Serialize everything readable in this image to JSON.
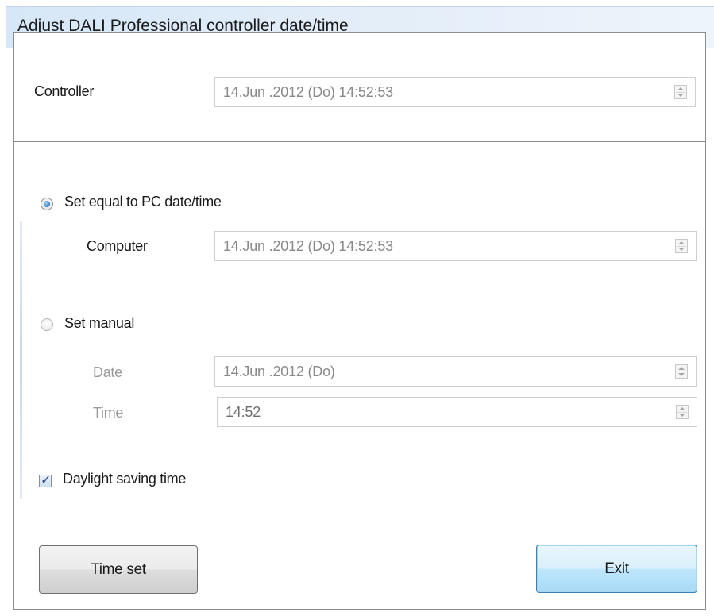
{
  "window": {
    "title": "Adjust DALI Professional controller date/time"
  },
  "controller": {
    "label": "Controller",
    "value": "14.Jun .2012 (Do)  14:52:53"
  },
  "options": {
    "pc_radio_label": "Set equal to PC date/time",
    "pc_radio_selected": true,
    "computer_label": "Computer",
    "computer_value": "14.Jun .2012 (Do)  14:52:53",
    "manual_radio_label": "Set manual",
    "manual_radio_selected": false,
    "date_label": "Date",
    "date_value": "14.Jun .2012 (Do)",
    "time_label": "Time",
    "time_value": "14:52"
  },
  "daylight": {
    "label": "Daylight saving time",
    "checked": true
  },
  "buttons": {
    "time_set": "Time set",
    "exit": "Exit"
  },
  "colors": {
    "accent": "#3c8ad0",
    "default_button_border": "#3c7fb1",
    "disabled_text": "#9a9a9a"
  },
  "icons": [
    "radio-selected-icon",
    "radio-unselected-icon",
    "checkbox-checked-icon",
    "spinner-icon"
  ]
}
